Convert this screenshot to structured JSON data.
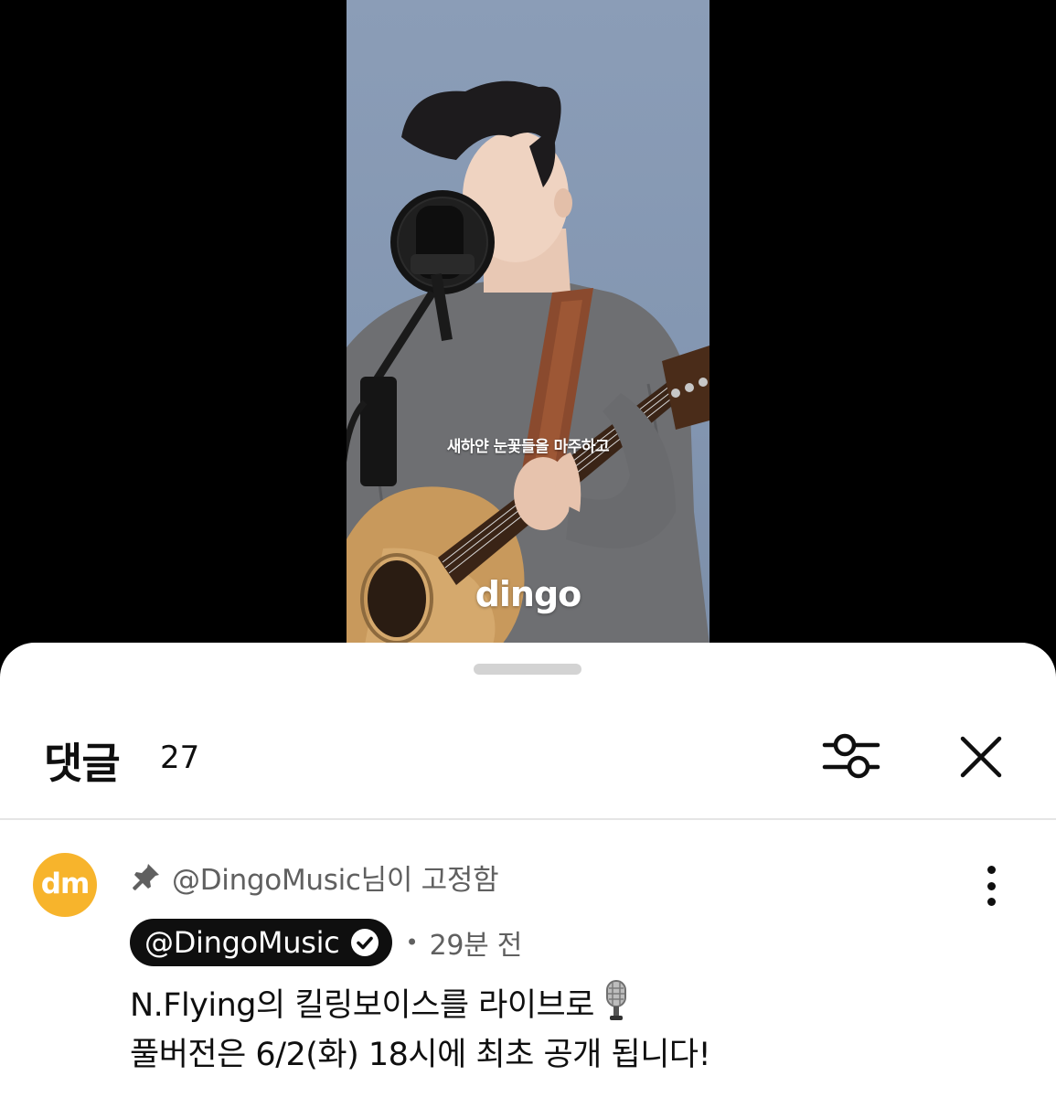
{
  "video": {
    "subtitle": "새하얀 눈꽃들을 마주하고",
    "watermark": "dingo"
  },
  "comments_panel": {
    "title": "댓글",
    "count": "27",
    "filter_icon": "sliders-icon",
    "close_icon": "close-icon"
  },
  "pinned_comment": {
    "avatar_text": "dm",
    "avatar_color": "#f7b42c",
    "pinned_label": "@DingoMusic님이 고정함",
    "author": "@DingoMusic",
    "time": "29분 전",
    "line1": "N.Flying의 킬링보이스를 라이브로",
    "line2": "풀버전은 6/2(화) 18시에 최초 공개 됩니다!",
    "emoji": "microphone-emoji"
  }
}
